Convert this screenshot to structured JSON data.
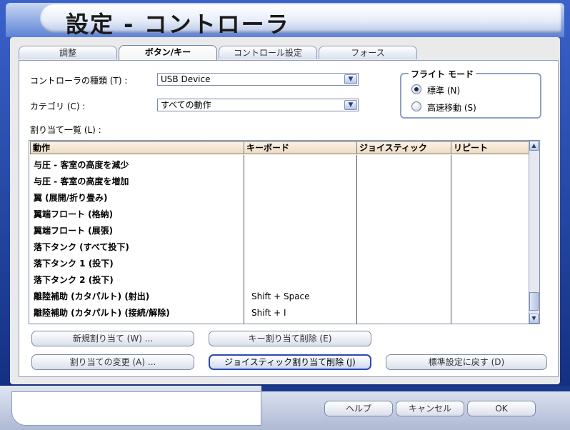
{
  "window": {
    "title": "設定 - コントローラ"
  },
  "tabs": [
    {
      "label": "調整",
      "active": false
    },
    {
      "label": "ボタン/キー",
      "active": true
    },
    {
      "label": "コントロール設定",
      "active": false
    },
    {
      "label": "フォース",
      "active": false
    }
  ],
  "controller_type": {
    "label": "コントローラの種類 (T) :",
    "value": "USB Device"
  },
  "category": {
    "label": "カテゴリ (C) :",
    "value": "すべての動作"
  },
  "assignments_label": "割り当て一覧 (L) :",
  "flight_mode": {
    "title": "フライト モード",
    "options": [
      {
        "label": "標準 (N)",
        "selected": true
      },
      {
        "label": "高速移動 (S)",
        "selected": false
      }
    ]
  },
  "table": {
    "headers": [
      "動作",
      "キーボード",
      "ジョイスティック",
      "リピート"
    ],
    "rows": [
      {
        "action": "与圧 - 客室の高度を減少",
        "keyboard": ""
      },
      {
        "action": "与圧 - 客室の高度を増加",
        "keyboard": ""
      },
      {
        "action": "翼 (展開/折り畳み)",
        "keyboard": ""
      },
      {
        "action": "翼端フロート (格納)",
        "keyboard": ""
      },
      {
        "action": "翼端フロート (展張)",
        "keyboard": ""
      },
      {
        "action": "落下タンク (すべて投下)",
        "keyboard": ""
      },
      {
        "action": "落下タンク 1 (投下)",
        "keyboard": ""
      },
      {
        "action": "落下タンク 2 (投下)",
        "keyboard": ""
      },
      {
        "action": "離陸補助 (カタパルト) (射出)",
        "keyboard": "Shift + Space"
      },
      {
        "action": "離陸補助 (カタパルト) (接続/解除)",
        "keyboard": "Shift + I"
      }
    ]
  },
  "buttons": {
    "new_assign": "新規割り当て (W) ...",
    "delete_key": "キー割り当て削除 (E)",
    "change_assign": "割り当ての変更 (A) ...",
    "delete_joystick": "ジョイスティック割り当て削除 (J)",
    "reset_default": "標準設定に戻す (D)",
    "help": "ヘルプ",
    "cancel": "キャンセル",
    "ok": "OK"
  }
}
